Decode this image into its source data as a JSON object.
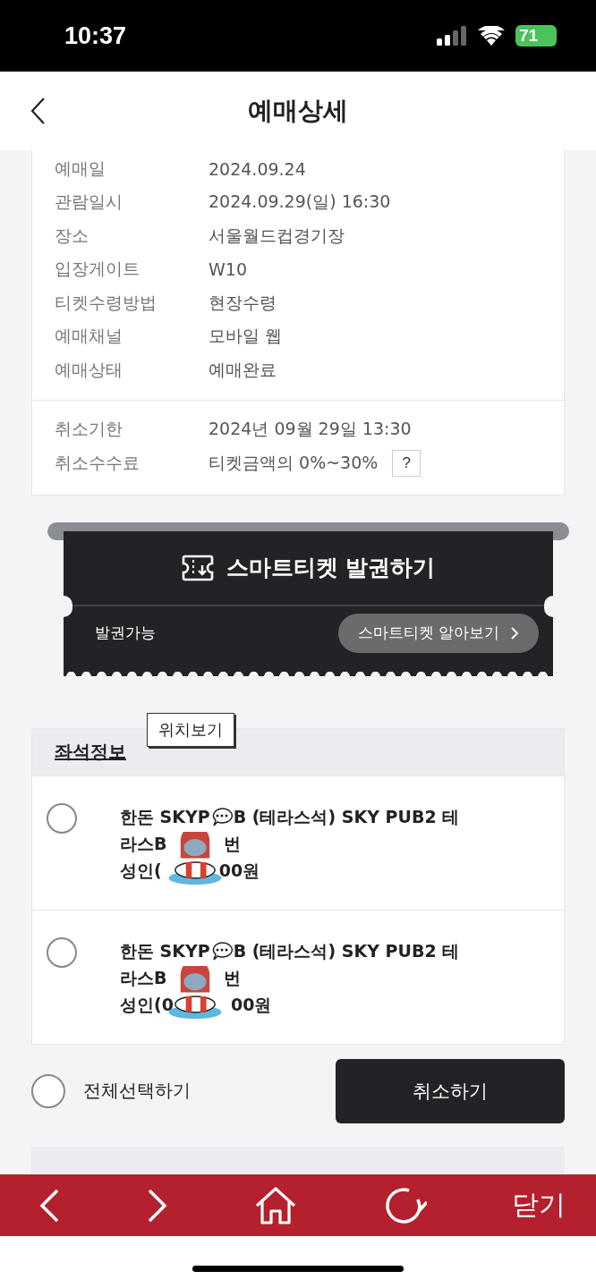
{
  "status_bar": {
    "time": "10:37",
    "battery": "71"
  },
  "header": {
    "title": "예매상세"
  },
  "booking_info": [
    {
      "label": "예매일",
      "value": "2024.09.24"
    },
    {
      "label": "관람일시",
      "value": "2024.09.29(일) 16:30"
    },
    {
      "label": "장소",
      "value": "서울월드컵경기장"
    },
    {
      "label": "입장게이트",
      "value": "W10"
    },
    {
      "label": "티켓수령방법",
      "value": "현장수령"
    },
    {
      "label": "예매채널",
      "value": "모바일 웹"
    },
    {
      "label": "예매상태",
      "value": "예매완료"
    }
  ],
  "cancel_info": [
    {
      "label": "취소기한",
      "value": "2024년 09월 29일 13:30",
      "help": false
    },
    {
      "label": "취소수수료",
      "value": "티켓금액의 0%~30%",
      "help": true,
      "help_label": "?"
    }
  ],
  "smart_ticket": {
    "title": "스마트티켓 발권하기",
    "status": "발권가능",
    "link": "스마트티켓 알아보기"
  },
  "seat_info": {
    "title": "좌석정보",
    "tooltip": "위치보기",
    "seats": [
      {
        "line1_parts": [
          "한돈 SKYP",
          "B (테라스석) SKY PUB2 테"
        ],
        "line2_parts": [
          "라스B",
          "번"
        ],
        "line3_parts": [
          "성인(",
          "00원"
        ],
        "selected": false
      },
      {
        "line1_parts": [
          "한돈 SKYP",
          "B (테라스석) SKY PUB2 테"
        ],
        "line2_parts": [
          "라스B",
          "번"
        ],
        "line3_parts": [
          "성인(0",
          "00원"
        ],
        "selected": false
      }
    ]
  },
  "select_all": {
    "label": "전체선택하기",
    "selected": false
  },
  "cancel_button": "취소하기",
  "bottom_nav": {
    "close": "닫기"
  }
}
